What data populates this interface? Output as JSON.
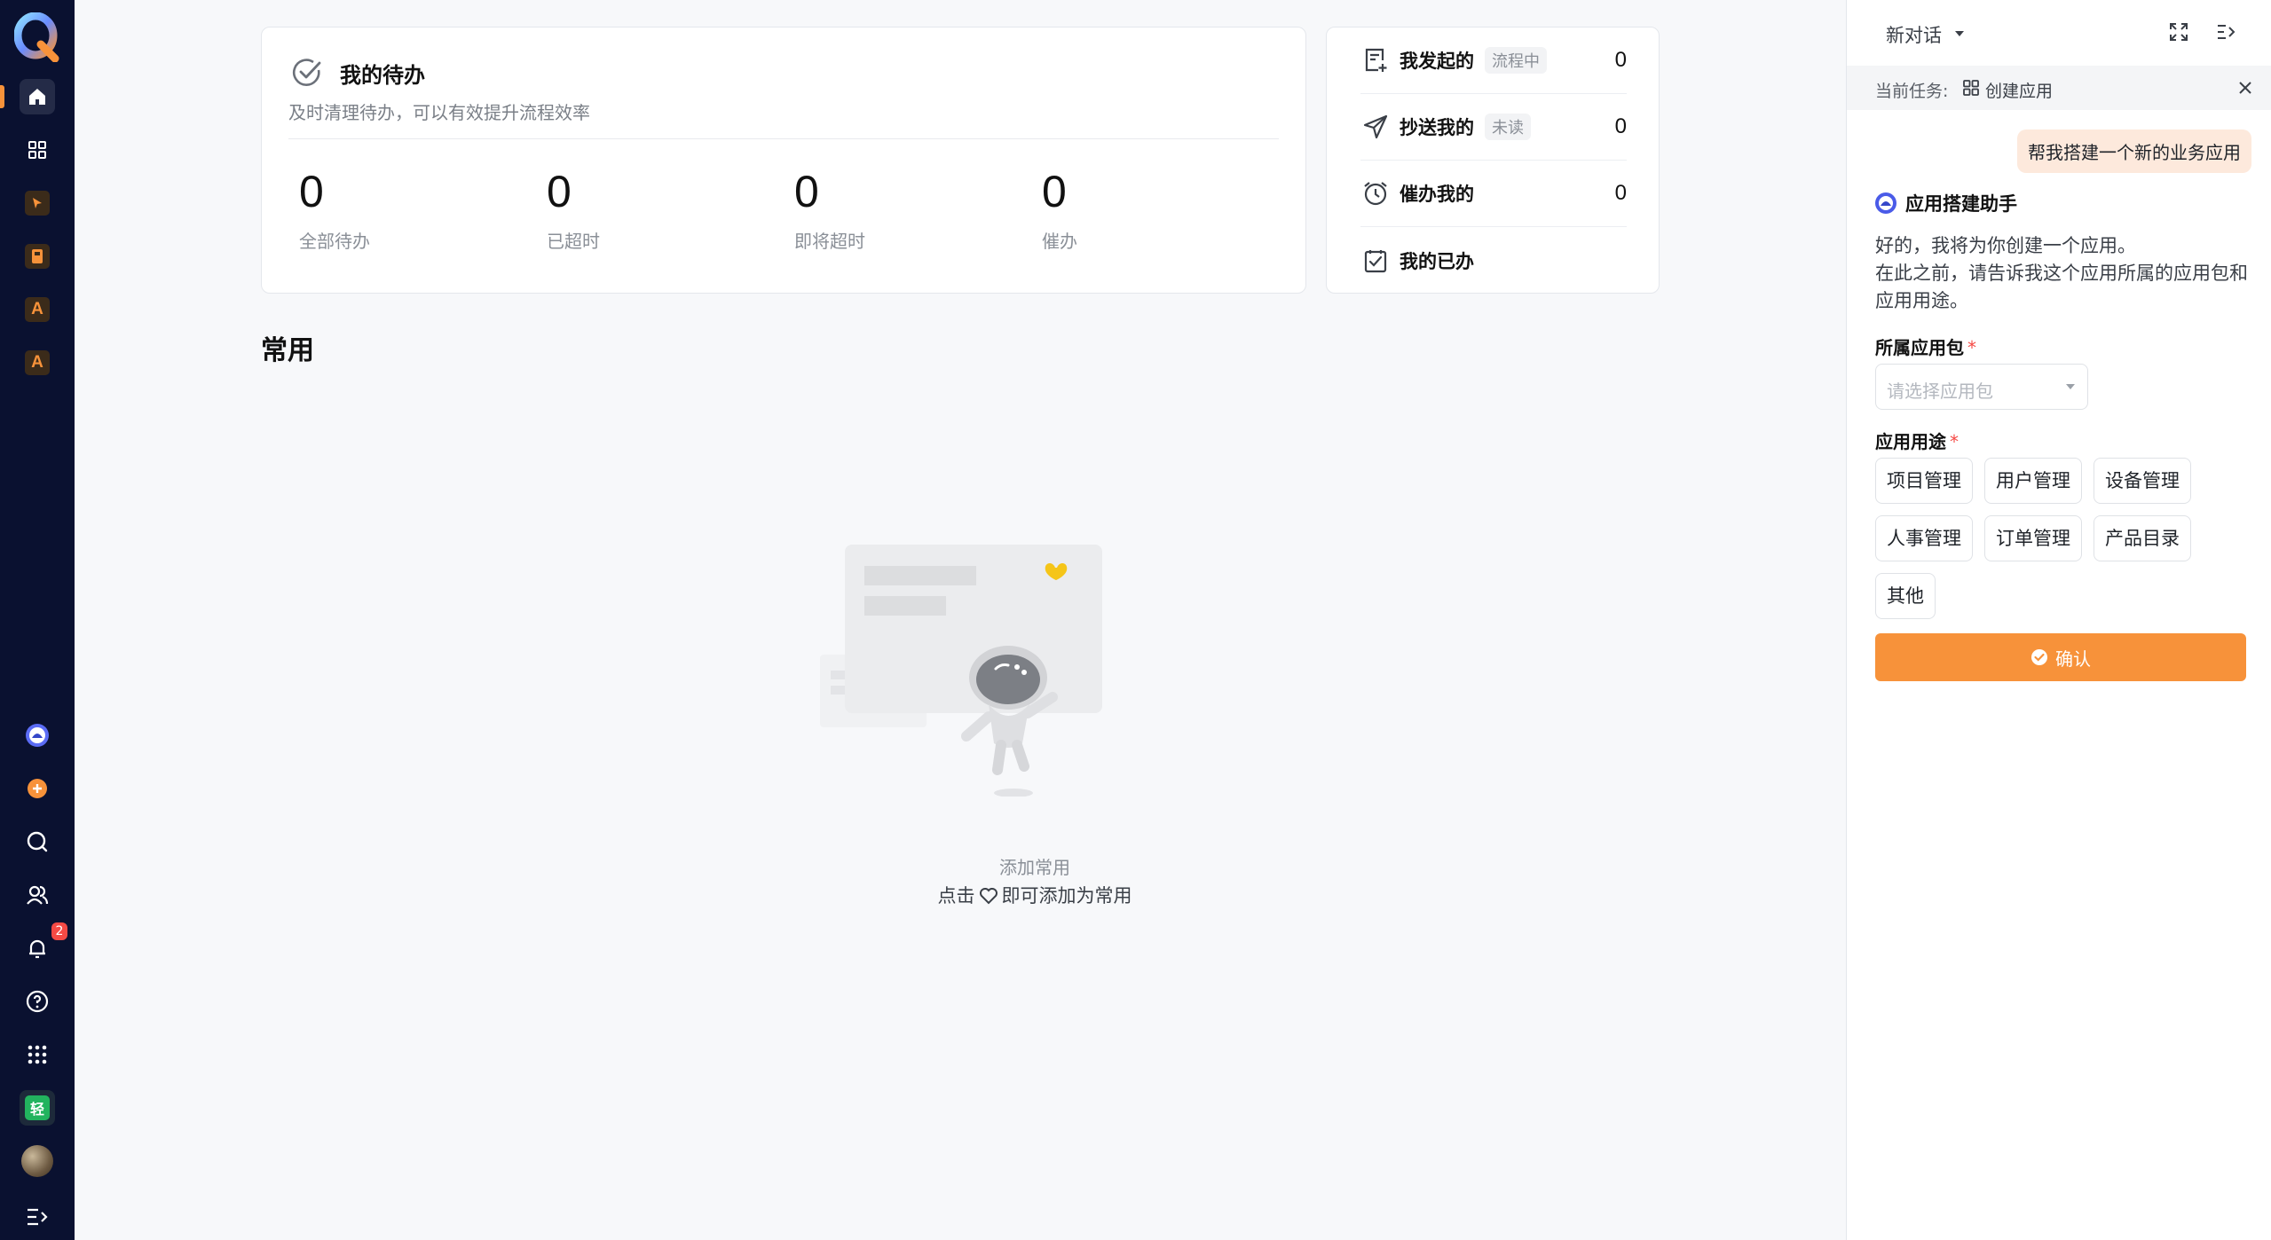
{
  "colors": {
    "nav_bg": "#0a1130",
    "accent": "#f7923a",
    "badge": "#f54a45",
    "user_bubble": "#fde9dc"
  },
  "left_nav": {
    "items": [
      {
        "icon": "home-icon"
      },
      {
        "icon": "apps-grid-icon"
      },
      {
        "icon": "cursor-app-icon"
      },
      {
        "icon": "book-app-icon"
      },
      {
        "icon": "app-a-icon",
        "letter": "A"
      },
      {
        "icon": "app-a-icon",
        "letter": "A"
      }
    ],
    "bottom": [
      {
        "icon": "assistant-icon"
      },
      {
        "icon": "add-icon"
      },
      {
        "icon": "search-icon"
      },
      {
        "icon": "contacts-icon"
      },
      {
        "icon": "bell-icon",
        "badge": "2"
      },
      {
        "icon": "help-icon"
      },
      {
        "icon": "apps-dots-icon"
      },
      {
        "icon": "qing-app-icon",
        "letter": "轻"
      },
      {
        "icon": "avatar"
      },
      {
        "icon": "expand-menu-icon"
      }
    ]
  },
  "todo": {
    "title": "我的待办",
    "subtitle": "及时清理待办，可以有效提升流程效率",
    "stats": [
      {
        "value": "0",
        "label": "全部待办"
      },
      {
        "value": "0",
        "label": "已超时"
      },
      {
        "value": "0",
        "label": "即将超时"
      },
      {
        "value": "0",
        "label": "催办"
      }
    ]
  },
  "flows": [
    {
      "label": "我发起的",
      "tag": "流程中",
      "count": "0",
      "icon": "doc-add-icon"
    },
    {
      "label": "抄送我的",
      "tag": "未读",
      "count": "0",
      "icon": "send-icon"
    },
    {
      "label": "催办我的",
      "tag": "",
      "count": "0",
      "icon": "alarm-clock-icon"
    },
    {
      "label": "我的已办",
      "tag": "",
      "count": "",
      "icon": "checkbox-icon"
    }
  ],
  "common": {
    "title": "常用",
    "empty_title": "添加常用",
    "empty_desc_before": "点击",
    "empty_desc_after": "即可添加为常用"
  },
  "assistant": {
    "conversation_label": "新对话",
    "current_task_label": "当前任务:",
    "current_task_value": "创建应用",
    "user_message": "帮我搭建一个新的业务应用",
    "bot_name": "应用搭建助手",
    "bot_line1": "好的，我将为你创建一个应用。",
    "bot_line2": "在此之前，请告诉我这个应用所属的应用包和应用用途。",
    "package_label": "所属应用包",
    "package_placeholder": "请选择应用包",
    "purpose_label": "应用用途",
    "required_mark": "*",
    "purposes": [
      "项目管理",
      "用户管理",
      "设备管理",
      "人事管理",
      "订单管理",
      "产品目录",
      "其他"
    ],
    "confirm_label": "确认"
  }
}
